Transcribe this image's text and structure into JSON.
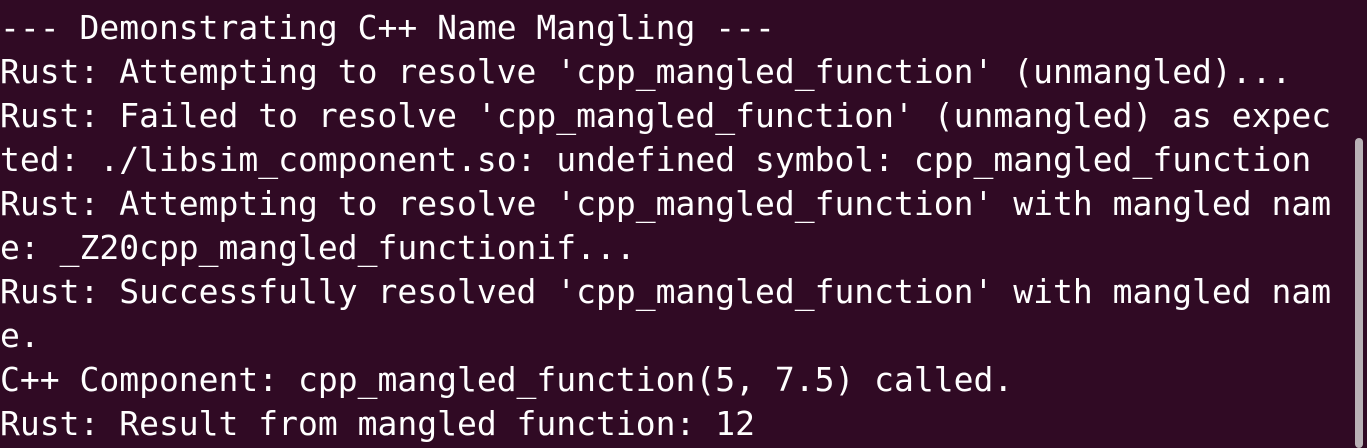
{
  "terminal": {
    "background_color": "#300a24",
    "text_color": "#ffffff",
    "lines": [
      "--- Demonstrating C++ Name Mangling ---",
      "Rust: Attempting to resolve 'cpp_mangled_function' (unmangled)...",
      "Rust: Failed to resolve 'cpp_mangled_function' (unmangled) as expec",
      "ted: ./libsim_component.so: undefined symbol: cpp_mangled_function",
      "Rust: Attempting to resolve 'cpp_mangled_function' with mangled nam",
      "e: _Z20cpp_mangled_functionif...",
      "Rust: Successfully resolved 'cpp_mangled_function' with mangled nam",
      "e.",
      "C++ Component: cpp_mangled_function(5, 7.5) called.",
      "Rust: Result from mangled function: 12"
    ]
  }
}
